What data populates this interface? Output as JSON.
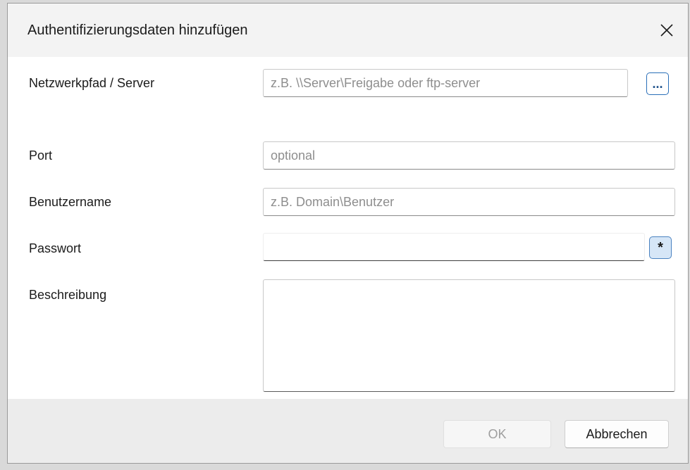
{
  "dialog": {
    "title": "Authentifizierungsdaten hinzufügen",
    "close_icon": "close-icon"
  },
  "fields": {
    "server": {
      "label": "Netzwerkpfad / Server",
      "value": "",
      "placeholder": "z.B. \\\\Server\\Freigabe oder ftp-server",
      "browse_label": "..."
    },
    "port": {
      "label": "Port",
      "value": "",
      "placeholder": "optional"
    },
    "username": {
      "label": "Benutzername",
      "value": "",
      "placeholder": "z.B. Domain\\Benutzer"
    },
    "password": {
      "label": "Passwort",
      "value": "",
      "toggle_label": "*"
    },
    "description": {
      "label": "Beschreibung",
      "value": ""
    }
  },
  "footer": {
    "ok_label": "OK",
    "cancel_label": "Abbrechen"
  },
  "colors": {
    "accent": "#2a6fb8",
    "titlebar": "#f3f3f3",
    "footer": "#ececec"
  }
}
